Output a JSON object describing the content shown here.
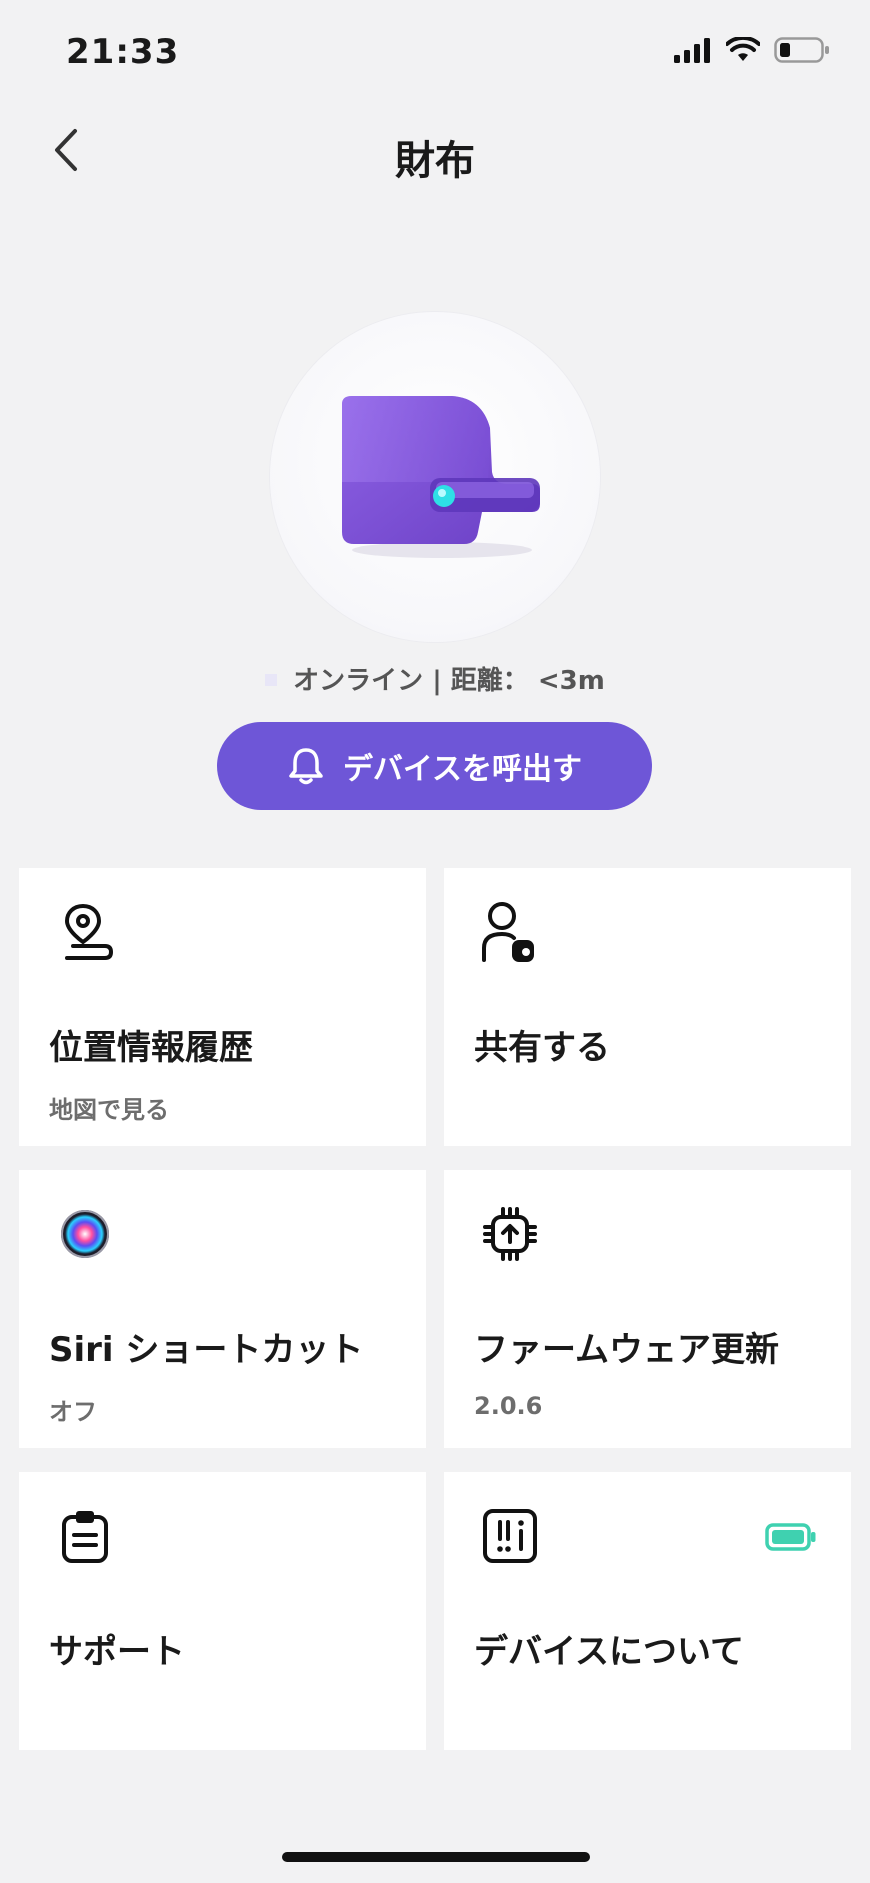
{
  "status_bar": {
    "time": "21:33"
  },
  "nav": {
    "title": "財布"
  },
  "device": {
    "status": "オンライン",
    "separator": "|",
    "distance_label": "距離：",
    "distance_value": "<3m"
  },
  "locate_button": {
    "label": "デバイスを呼出す"
  },
  "cards": [
    {
      "title": "位置情報履歴",
      "subtitle": "地図で見る",
      "icon": "location-pin-icon"
    },
    {
      "title": "共有する",
      "subtitle": "",
      "icon": "share-user-icon"
    },
    {
      "title": "Siri ショートカット",
      "subtitle": "オフ",
      "icon": "siri-icon"
    },
    {
      "title": "ファームウェア更新",
      "subtitle": "2.0.6",
      "icon": "chip-upload-icon"
    },
    {
      "title": "サポート",
      "subtitle": "",
      "icon": "clipboard-icon"
    },
    {
      "title": "デバイスについて",
      "subtitle": "",
      "icon": "device-info-icon"
    }
  ],
  "colors": {
    "accent": "#6e56d7",
    "background": "#f2f2f3",
    "battery": "#3fd1b0",
    "device": "#7a4fd0"
  }
}
